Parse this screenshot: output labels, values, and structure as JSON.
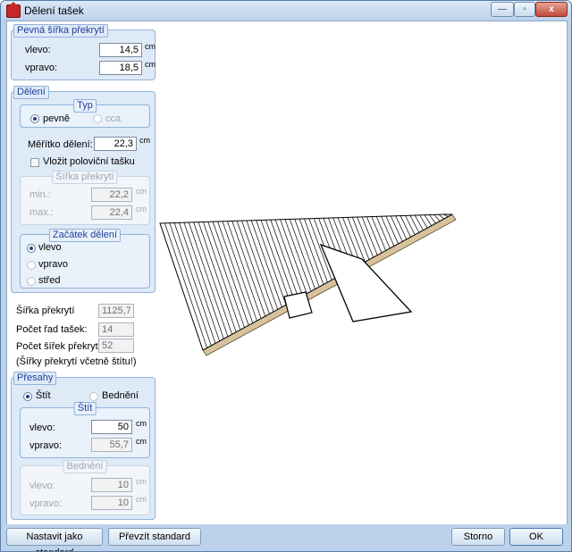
{
  "window": {
    "title": "Dělení tašek",
    "minimize_label": "—",
    "maximize_label": "▫",
    "close_label": "x"
  },
  "fixed_overlap_width": {
    "legend": "Pevná šířka překrytí",
    "left_label": "vlevo:",
    "left_value": "14,5",
    "left_unit": "cm",
    "right_label": "vpravo:",
    "right_value": "18,5",
    "right_unit": "cm"
  },
  "division": {
    "legend": "Dělení",
    "type": {
      "legend": "Typ",
      "option_fixed": "pevně",
      "option_approx": "cca",
      "selected": "pevně"
    },
    "scale_label": "Měřítko dělení:",
    "scale_value": "22,3",
    "scale_unit": "cm",
    "half_tile_label": "Vložit poloviční tašku",
    "half_tile_checked": false,
    "overlap_width": {
      "legend": "Šířka překrytí",
      "min_label": "min.:",
      "min_value": "22,2",
      "min_unit": "cm",
      "max_label": "max.:",
      "max_value": "22,4",
      "max_unit": "cm"
    },
    "start": {
      "legend": "Začátek dělení",
      "option_left": "vlevo",
      "option_right": "vpravo",
      "option_center": "střed",
      "selected": "vlevo"
    }
  },
  "summary": {
    "overlap_width_label": "Šířka překrytí",
    "overlap_width_value": "1125,7",
    "rows_label": "Počet řad tašek:",
    "rows_value": "14",
    "widths_label": "Počet šířek překrytí:",
    "widths_value": "52",
    "note": "(Šířky překrytí včetně štítu!)"
  },
  "overhangs": {
    "legend": "Přesahy",
    "option_gable": "Štít",
    "option_boarding": "Bednění",
    "selected": "Štít",
    "gable": {
      "legend": "Štít",
      "left_label": "vlevo:",
      "left_value": "50",
      "left_unit": "cm",
      "right_label": "vpravo:",
      "right_value": "55,7",
      "right_unit": "cm"
    },
    "boarding": {
      "legend": "Bednění",
      "left_label": "vlevo:",
      "left_value": "10",
      "left_unit": "cm",
      "right_label": "vpravo:",
      "right_value": "10",
      "right_unit": "cm"
    }
  },
  "buttons": {
    "set_standard": "Nastavit jako standard",
    "take_standard": "Převzít standard",
    "cancel": "Storno",
    "ok": "OK"
  },
  "colors": {
    "accent_blue": "#1f3f99",
    "group_border": "#8fb2dc",
    "window_frame": "#bcd2ea"
  }
}
